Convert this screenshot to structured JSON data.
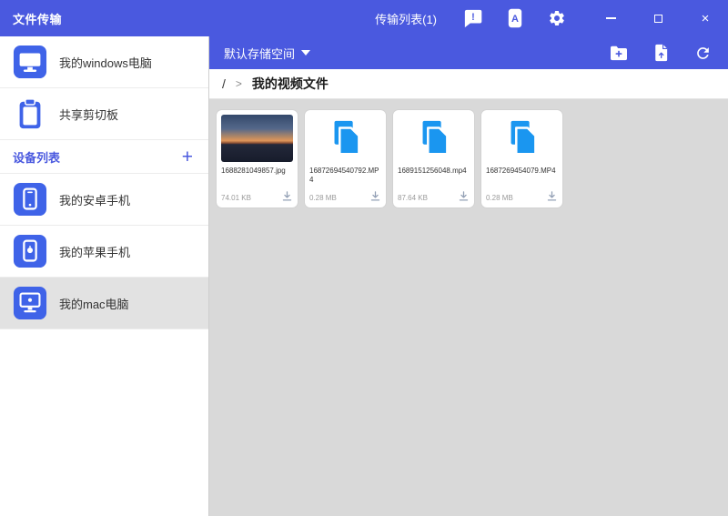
{
  "colors": {
    "header_blue": "#4a59df",
    "file_icon_blue": "#1a96f0",
    "sidebar_icon_blue": "#3f63e8"
  },
  "titlebar": {
    "title": "文件传输",
    "transfer_list_label": "传输列表(1)",
    "feedback_mark": "!",
    "phone_letter": "A",
    "close_glyph": "×"
  },
  "sidebar": {
    "computer_label": "我的windows电脑",
    "clipboard_label": "共享剪切板",
    "device_list_label": "设备列表",
    "add_glyph": "+",
    "devices": [
      {
        "label": "我的安卓手机",
        "selected": false
      },
      {
        "label": "我的苹果手机",
        "selected": false
      },
      {
        "label": "我的mac电脑",
        "selected": true
      }
    ]
  },
  "toolbar": {
    "storage_label": "默认存储空间"
  },
  "breadcrumb": {
    "root": "/",
    "separator": ">",
    "current": "我的视频文件"
  },
  "files": [
    {
      "name": "1688281049857.jpg",
      "size": "74.01 KB",
      "kind": "image"
    },
    {
      "name": "16872694540792.MP4",
      "size": "0.28 MB",
      "kind": "video"
    },
    {
      "name": "1689151256048.mp4",
      "size": "87.64 KB",
      "kind": "video"
    },
    {
      "name": "1687269454079.MP4",
      "size": "0.28 MB",
      "kind": "video"
    }
  ]
}
